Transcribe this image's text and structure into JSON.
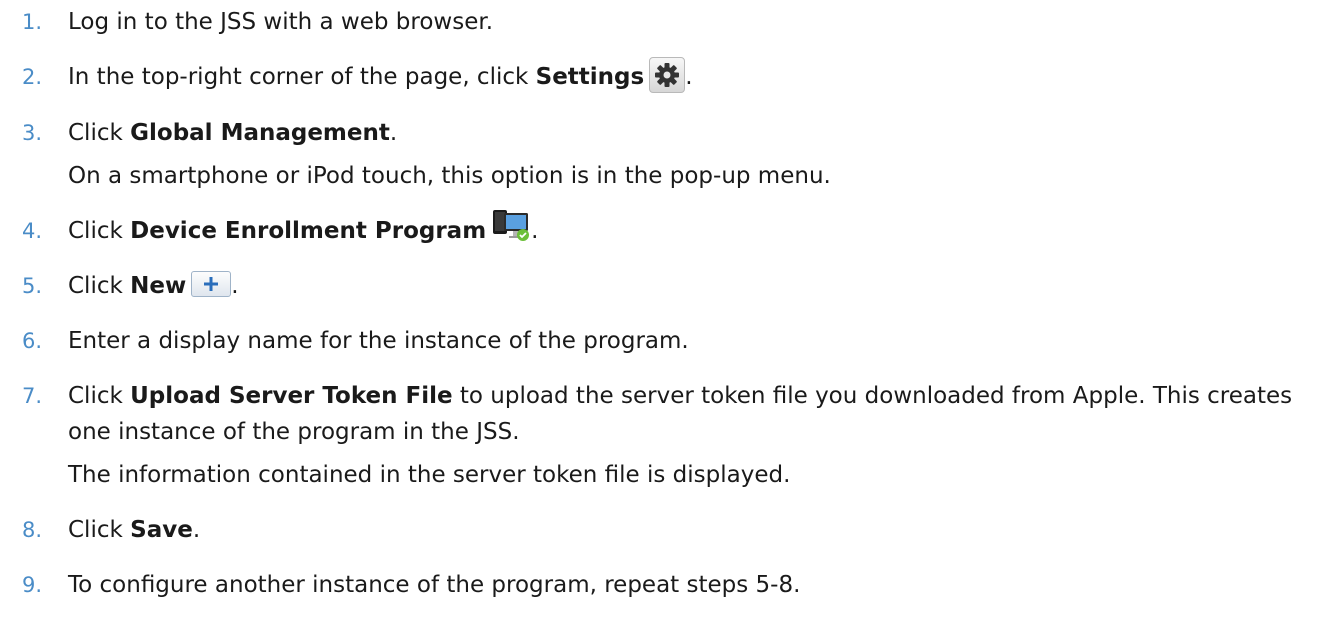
{
  "steps": [
    {
      "num": "1.",
      "text": "Log in to the JSS with a web browser."
    },
    {
      "num": "2.",
      "pre": "In the top-right corner of the page, click ",
      "bold": "Settings",
      "icon": "gear-icon",
      "post": "."
    },
    {
      "num": "3.",
      "pre": "Click ",
      "bold": "Global Management",
      "post": ".",
      "sub": "On a smartphone or iPod touch, this option is in the pop-up menu."
    },
    {
      "num": "4.",
      "pre": "Click ",
      "bold": "Device Enrollment Program",
      "icon": "device-enrollment-icon",
      "post": "."
    },
    {
      "num": "5.",
      "pre": "Click ",
      "bold": "New",
      "icon": "plus-icon",
      "post": "."
    },
    {
      "num": "6.",
      "text": "Enter a display name for the instance of the program."
    },
    {
      "num": "7.",
      "pre": "Click ",
      "bold": "Upload Server Token File",
      "post": " to upload the server token file you downloaded from Apple. This creates one instance of the program in the JSS.",
      "sub": "The information contained in the server token file is displayed."
    },
    {
      "num": "8.",
      "pre": "Click ",
      "bold": "Save",
      "post": "."
    },
    {
      "num": "9.",
      "text": "To configure another instance of the program, repeat steps 5-8."
    }
  ],
  "colors": {
    "step_number": "#4a8cc7",
    "text": "#1a1a1a",
    "plus_accent": "#2a6ebb",
    "check_green": "#6cbf3a"
  }
}
